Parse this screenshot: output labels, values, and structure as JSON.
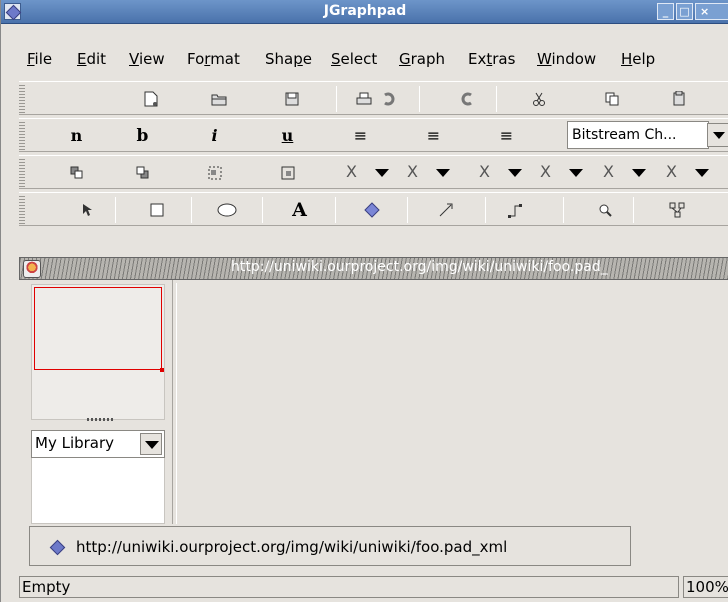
{
  "window": {
    "title": "JGraphpad",
    "minimize": "_",
    "maximize": "□",
    "close": "×"
  },
  "menubar": [
    {
      "label": "File",
      "u": "F",
      "rest": "ile"
    },
    {
      "label": "Edit",
      "u": "E",
      "rest": "dit"
    },
    {
      "label": "View",
      "u": "V",
      "rest": "iew"
    },
    {
      "label": "Format",
      "pre": "Fo",
      "u": "r",
      "rest": "mat"
    },
    {
      "label": "Shape",
      "pre": "Sha",
      "u": "p",
      "rest": "e"
    },
    {
      "label": "Select",
      "u": "S",
      "rest": "elect"
    },
    {
      "label": "Graph",
      "u": "G",
      "rest": "raph"
    },
    {
      "label": "Extras",
      "pre": "Ex",
      "u": "t",
      "rest": "ras"
    },
    {
      "label": "Window",
      "u": "W",
      "rest": "indow"
    },
    {
      "label": "Help",
      "u": "H",
      "rest": "elp"
    }
  ],
  "toolbar_standard": [
    "new-icon",
    "open-icon",
    "save-icon",
    "print-icon",
    "undo-icon",
    "redo-icon",
    "cut-icon",
    "copy-icon",
    "paste-icon"
  ],
  "toolbar_format": {
    "normal": "n",
    "bold": "b",
    "italic": "i",
    "underline": "u",
    "align_left": "≡",
    "align_center": "≡",
    "align_right": "≡",
    "font_value": "Bitstream Ch..."
  },
  "toolbar_arrange": {
    "x_label": "X",
    "combos": [
      "X",
      "X",
      "X",
      "X",
      "X",
      "X"
    ]
  },
  "toolbar_tools": [
    "select-tool-icon",
    "rectangle-tool-icon",
    "ellipse-tool-icon",
    "text-tool-icon",
    "diamond-tool-icon",
    "edge-tool-icon",
    "orthogonal-edge-tool-icon",
    "zoom-tool-icon",
    "layout-tool-icon"
  ],
  "tool_labels": {
    "text": "A"
  },
  "internal_frame": {
    "title": "http://uniwiki.ourproject.org/img/wiki/uniwiki/foo.pad_"
  },
  "library": {
    "selected": "My Library"
  },
  "document_tab": {
    "label": "http://uniwiki.ourproject.org/img/wiki/uniwiki/foo.pad_xml"
  },
  "status": {
    "message": "Empty",
    "zoom": "100%"
  },
  "colors": {
    "titlebar": "#4a72ab",
    "library_cell_border": "#e00000",
    "background": "#e6e3de"
  }
}
